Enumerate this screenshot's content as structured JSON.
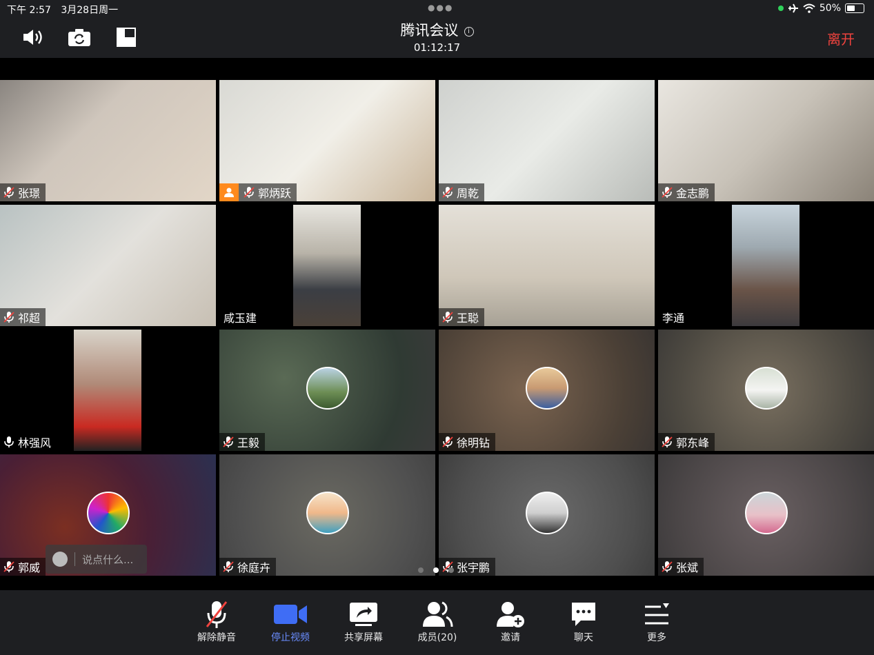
{
  "status": {
    "time": "下午 2:57",
    "date": "3月28日周一",
    "battery": "50%",
    "battery_level": 0.5
  },
  "header": {
    "title": "腾讯会议",
    "timer": "01:12:17",
    "leave_label": "离开"
  },
  "participants": [
    {
      "name": "张璟",
      "mic": "muted",
      "type": "video"
    },
    {
      "name": "郭炳跃",
      "mic": "muted",
      "type": "video",
      "host": true
    },
    {
      "name": "周乾",
      "mic": "muted",
      "type": "video"
    },
    {
      "name": "金志鹏",
      "mic": "muted",
      "type": "video"
    },
    {
      "name": "祁超",
      "mic": "muted",
      "type": "video"
    },
    {
      "name": "咸玉建",
      "mic": "none",
      "type": "video"
    },
    {
      "name": "王聪",
      "mic": "muted",
      "type": "video"
    },
    {
      "name": "李通",
      "mic": "none",
      "type": "video"
    },
    {
      "name": "林强风",
      "mic": "on",
      "type": "video",
      "active": true
    },
    {
      "name": "王毅",
      "mic": "muted",
      "type": "avatar"
    },
    {
      "name": "徐明钻",
      "mic": "muted",
      "type": "avatar"
    },
    {
      "name": "郭东峰",
      "mic": "muted",
      "type": "avatar"
    },
    {
      "name": "郭威",
      "mic": "muted",
      "type": "avatar"
    },
    {
      "name": "徐庭卉",
      "mic": "muted",
      "type": "avatar"
    },
    {
      "name": "张宇鹏",
      "mic": "muted",
      "type": "avatar"
    },
    {
      "name": "张斌",
      "mic": "muted",
      "type": "avatar"
    }
  ],
  "chat": {
    "placeholder": "说点什么..."
  },
  "toolbar": {
    "unmute": "解除静音",
    "stop_video": "停止视频",
    "share_screen": "共享屏幕",
    "members": "成员(20)",
    "invite": "邀请",
    "chat": "聊天",
    "more": "更多"
  },
  "colors": {
    "accent_blue": "#3f6df5",
    "leave_red": "#f0433e",
    "speaker_green": "#23c25b",
    "host_orange": "#ff8a1d"
  }
}
